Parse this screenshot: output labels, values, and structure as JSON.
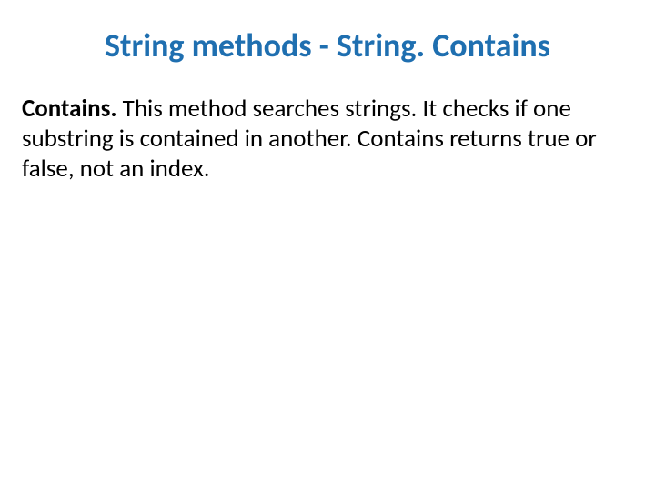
{
  "slide": {
    "title": "String methods - String. Contains",
    "body": {
      "lead": "Contains.",
      "rest": " This method searches strings. It checks if one substring is contained in another. Contains returns true or false, not an index."
    }
  }
}
